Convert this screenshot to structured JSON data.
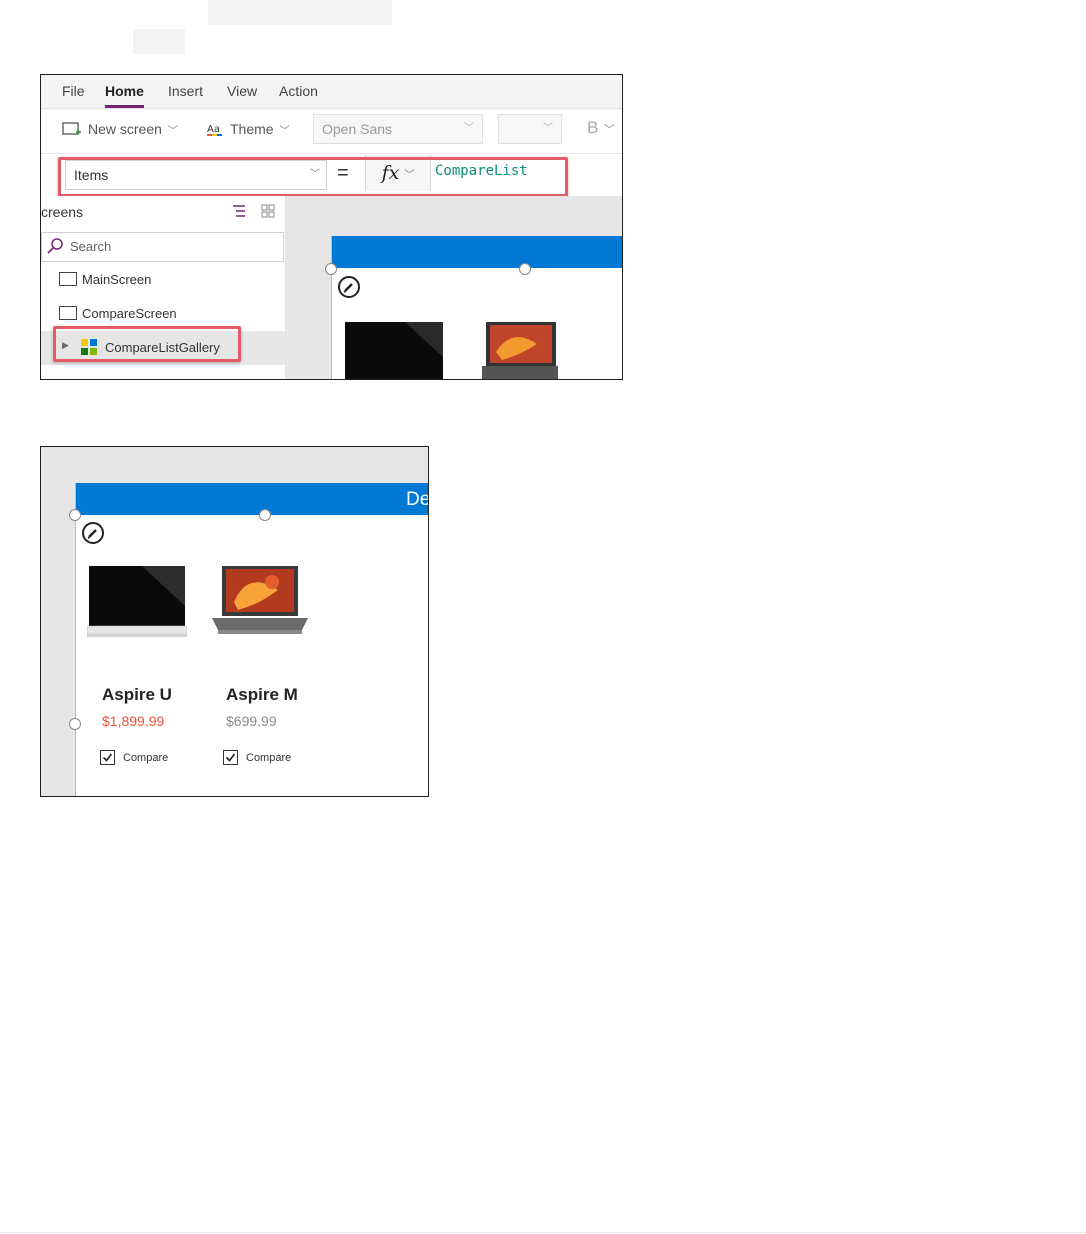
{
  "menu": {
    "items": [
      "File",
      "Home",
      "Insert",
      "View",
      "Action"
    ],
    "active": "Home"
  },
  "toolbar": {
    "new_screen": "New screen",
    "theme": "Theme",
    "font": "Open Sans",
    "bold": "B"
  },
  "formula_bar": {
    "property": "Items",
    "equals": "=",
    "fx": "fx",
    "formula": "CompareList"
  },
  "tree_view": {
    "header": "creens",
    "search_placeholder": "Search",
    "items": [
      {
        "label": "MainScreen",
        "type": "screen"
      },
      {
        "label": "CompareScreen",
        "type": "screen"
      },
      {
        "label": "CompareListGallery",
        "type": "gallery",
        "selected": true
      }
    ]
  },
  "gallery_preview": {
    "header_title": "De",
    "products": [
      {
        "name": "Aspire U",
        "price": "$1,899.99",
        "price_color": "#e8533c",
        "compare_label": "Compare",
        "checked": true,
        "image": "monitor-image"
      },
      {
        "name": "Aspire M",
        "price": "$699.99",
        "price_color": "#8a8a8a",
        "compare_label": "Compare",
        "checked": true,
        "image": "laptop-image"
      }
    ]
  },
  "colors": {
    "accent": "#742774",
    "header_blue": "#0078d4",
    "highlight": "#e35b64",
    "formula_text": "#0a8f7a"
  }
}
